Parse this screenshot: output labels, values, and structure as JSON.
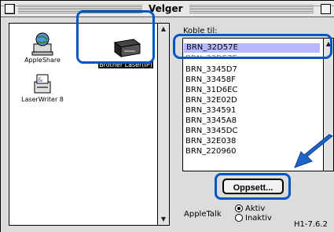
{
  "window": {
    "title": "Velger"
  },
  "devices": [
    {
      "label": "AppleShare",
      "icon": "appleshare-icon"
    },
    {
      "label": "Brother Laser(IP)",
      "icon": "printer-icon",
      "selected": true
    },
    {
      "label": "LaserWriter 8",
      "icon": "laserwriter-icon"
    }
  ],
  "connect": {
    "label": "Koble til:",
    "items": [
      "BRN_32D57E",
      "BRN_3345D7",
      "BRN_33458F",
      "BRN_31D6EC",
      "BRN_32E02D",
      "BRN_334591",
      "BRN_3345A8",
      "BRN_3345DC",
      "BRN_32E038",
      "BRN_220960"
    ],
    "selected": "BRN_32D57E"
  },
  "setup_button": {
    "label": "Oppsett..."
  },
  "appletalk": {
    "label": "AppleTalk",
    "options": [
      "Aktiv",
      "Inaktiv"
    ],
    "selected": "Aktiv"
  },
  "version": "H1-7.6.2",
  "colors": {
    "highlight": "#0057c4",
    "list_selection": "#b8b8ff"
  }
}
